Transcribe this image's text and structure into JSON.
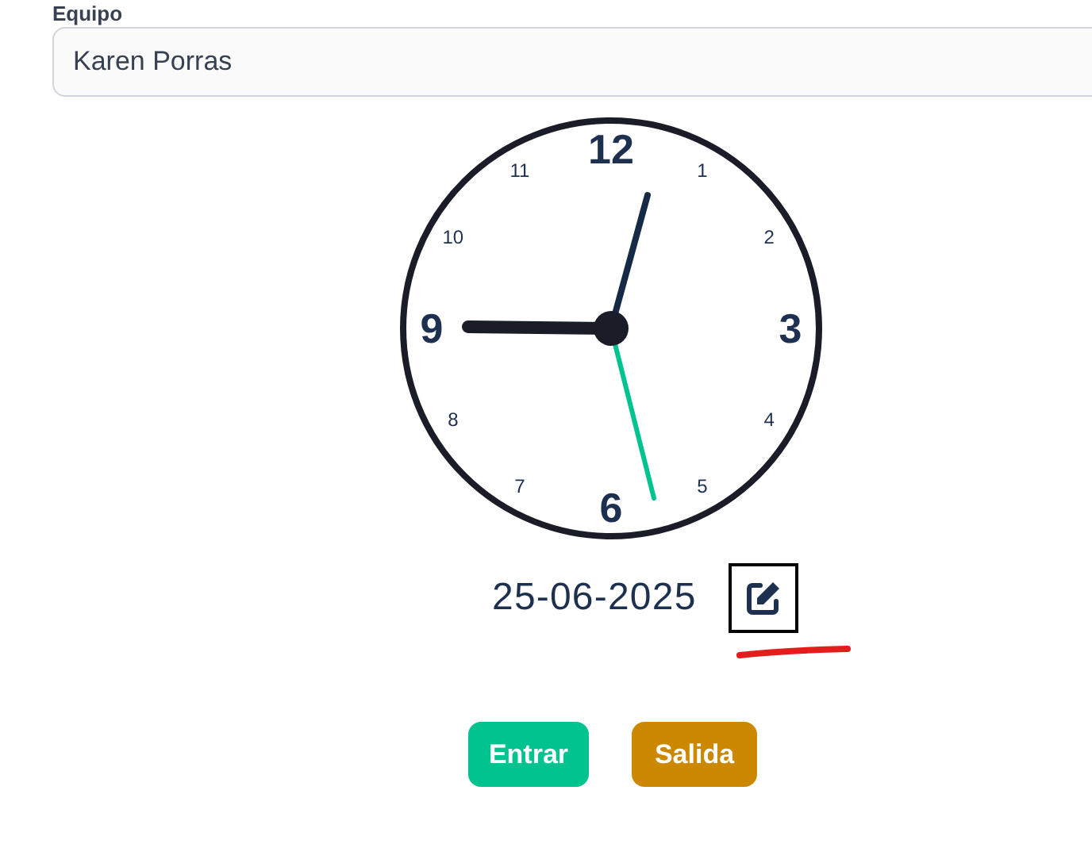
{
  "field": {
    "label": "Equipo",
    "value": "Karen Porras"
  },
  "clock_numbers": [
    {
      "text": "12",
      "kind": "major"
    },
    {
      "text": "1",
      "kind": "minor"
    },
    {
      "text": "2",
      "kind": "minor"
    },
    {
      "text": "3",
      "kind": "major"
    },
    {
      "text": "4",
      "kind": "minor"
    },
    {
      "text": "5",
      "kind": "minor"
    },
    {
      "text": "6",
      "kind": "major"
    },
    {
      "text": "7",
      "kind": "minor"
    },
    {
      "text": "8",
      "kind": "minor"
    },
    {
      "text": "9",
      "kind": "major"
    },
    {
      "text": "10",
      "kind": "minor"
    },
    {
      "text": "11",
      "kind": "minor"
    }
  ],
  "date": "25-06-2025",
  "buttons": [
    {
      "label": "Entrar",
      "kind": "enter"
    },
    {
      "label": "Salida",
      "kind": "exit"
    }
  ]
}
